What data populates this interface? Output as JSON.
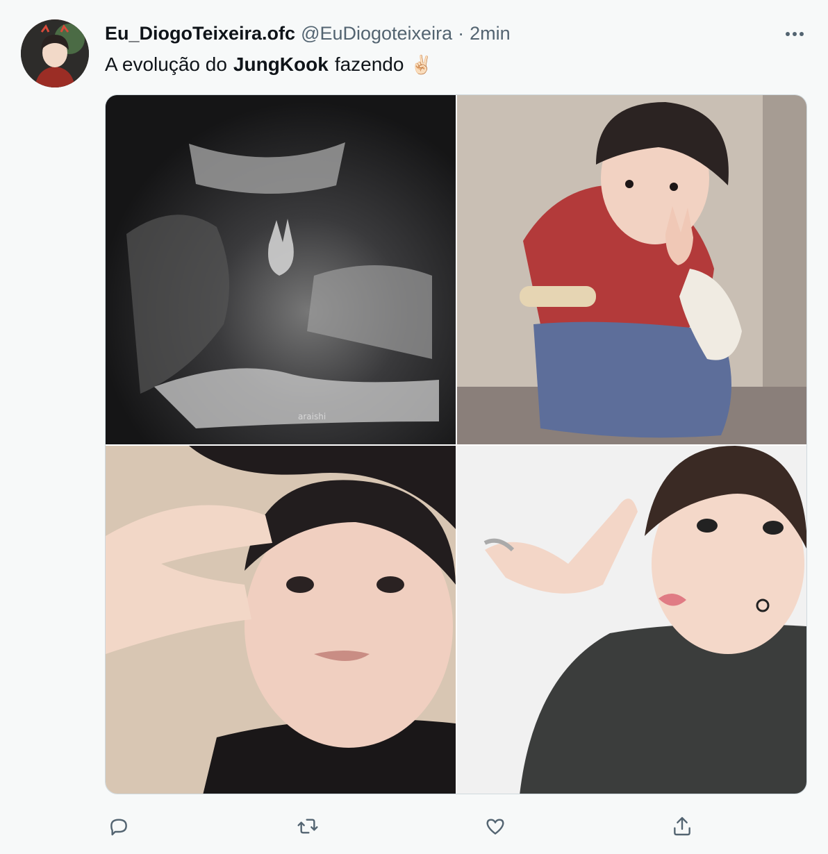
{
  "tweet": {
    "display_name": "Eu_DiogoTeixeira.ofc",
    "handle": "@EuDiogoteixeira",
    "separator": "·",
    "timestamp": "2min",
    "text_before": "A evolução do",
    "text_bold": "JungKook",
    "text_after": "fazendo",
    "emoji": "✌🏻"
  },
  "media": {
    "watermark": "araishi",
    "photos": [
      "ultrasound-photo",
      "child-photo",
      "teen-photo",
      "adult-photo"
    ]
  },
  "actions": {
    "icons": [
      "reply-icon",
      "retweet-icon",
      "like-icon",
      "share-icon"
    ]
  },
  "colors": {
    "background": "#f7f9f9",
    "text_primary": "#0f1419",
    "text_secondary": "#536471",
    "border": "#cfd9de"
  }
}
